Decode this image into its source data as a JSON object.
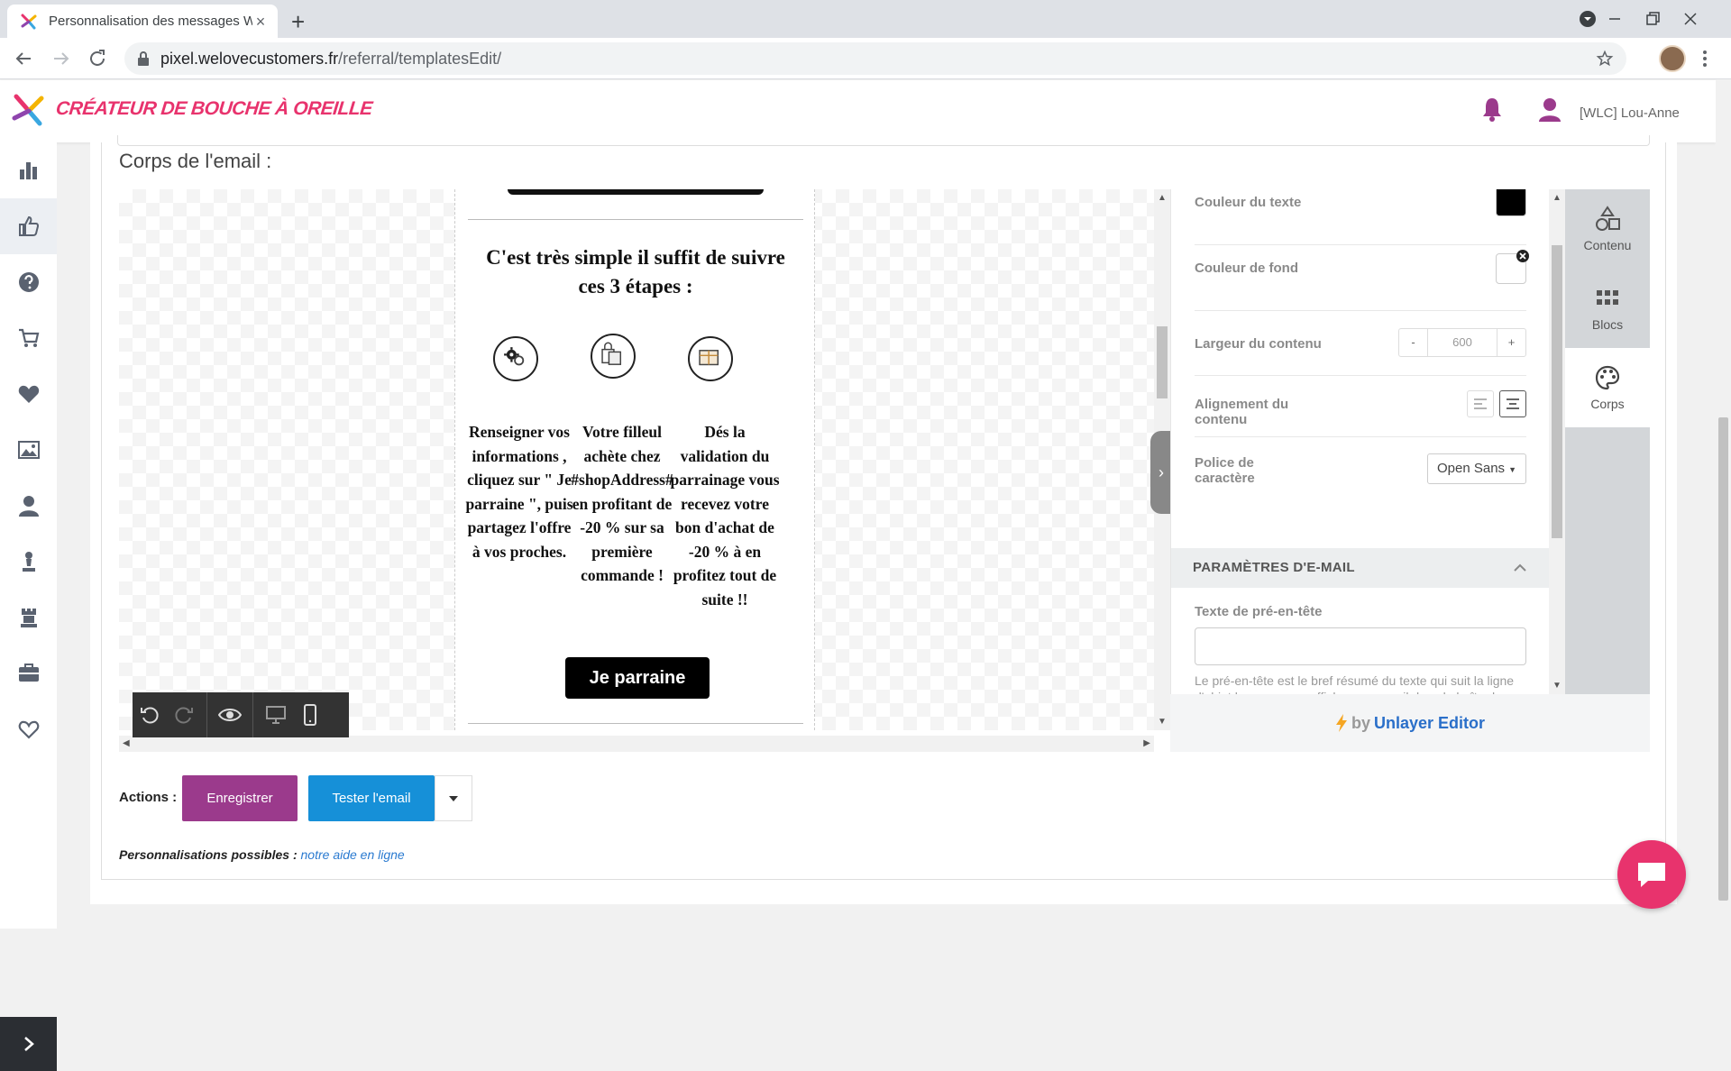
{
  "browser": {
    "tab_title": "Personnalisation des messages W",
    "url_domain": "pixel.welovecustomers.fr",
    "url_path": "/referral/templatesEdit/"
  },
  "app": {
    "brand": "CRÉATEUR DE BOUCHE À OREILLE",
    "brand_color": "#e8336d",
    "user": "[WLC] Lou-Anne",
    "sidebar_icons": [
      "bar-chart-icon",
      "thumbs-up-icon",
      "help-circle-icon",
      "cart-icon",
      "heart-icon",
      "image-icon",
      "user-icon",
      "chess-pawn-icon",
      "chess-rook-icon",
      "briefcase-icon",
      "heart-outline-icon"
    ]
  },
  "editor": {
    "section_label": "Corps de l'email :",
    "email": {
      "heading": "C'est très simple il suffit de suivre ces 3 étapes :",
      "steps": [
        "Renseigner vos informations , cliquez sur \" Je parraine \", puis partagez l'offre à vos proches.",
        "Votre filleul achète chez #shopAddress# en profitant de -20 % sur sa première commande !",
        "Dés la validation du parrainage vous recevez votre bon d'achat de -20 % à en profitez tout de suite !!"
      ],
      "cta": "Je parraine"
    },
    "panel": {
      "text_color_label": "Couleur du texte",
      "text_color": "#000000",
      "bg_color_label": "Couleur de fond",
      "width_label": "Largeur du contenu",
      "width_minus": "-",
      "width_value": "600",
      "width_plus": "+",
      "align_label": "Alignement du contenu",
      "font_label": "Police de caractère",
      "font_value": "Open Sans",
      "email_params": "PARAMÈTRES D'E-MAIL",
      "preheader_label": "Texte de pré-en-tête",
      "preheader_hint": "Le pré-en-tête est le bref résumé du texte qui suit la ligne d'objet lorsque vous affichez un e-mail dans la boîte de"
    },
    "tabs": [
      "Contenu",
      "Blocs",
      "Corps"
    ],
    "powered_by": "by",
    "powered_name": "Unlayer Editor"
  },
  "actions": {
    "label": "Actions :",
    "save": "Enregistrer",
    "test": "Tester l'email",
    "save_color": "#9b3a8c",
    "test_color": "#1690d8"
  },
  "help": {
    "label": "Personnalisations possibles :",
    "link": "notre aide en ligne"
  }
}
